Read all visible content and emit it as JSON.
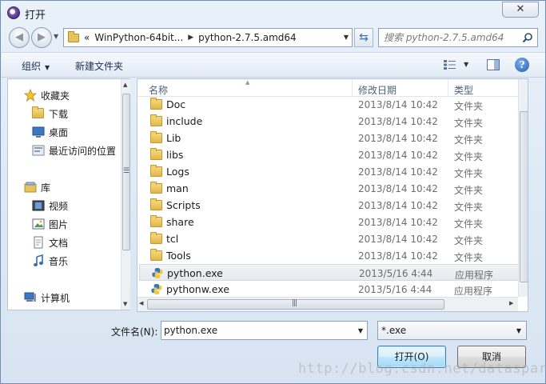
{
  "window": {
    "title": "打开",
    "close_glyph": "✕"
  },
  "nav": {
    "address": [
      "WinPython-64bit...",
      "python-2.7.5.amd64"
    ],
    "address_prefix": "«",
    "search_placeholder": "搜索 python-2.7.5.amd64"
  },
  "toolbar": {
    "organize": "组织",
    "new_folder": "新建文件夹"
  },
  "sidebar": {
    "favorites": {
      "label": "收藏夹",
      "items": [
        "下载",
        "桌面",
        "最近访问的位置"
      ]
    },
    "libraries": {
      "label": "库",
      "items": [
        "视频",
        "图片",
        "文档",
        "音乐"
      ]
    },
    "computer": "计算机"
  },
  "columns": {
    "name": "名称",
    "date": "修改日期",
    "type": "类型"
  },
  "files": [
    {
      "name": "Doc",
      "date": "2013/8/14 10:42",
      "type": "文件夹",
      "kind": "folder"
    },
    {
      "name": "include",
      "date": "2013/8/14 10:42",
      "type": "文件夹",
      "kind": "folder"
    },
    {
      "name": "Lib",
      "date": "2013/8/14 10:42",
      "type": "文件夹",
      "kind": "folder"
    },
    {
      "name": "libs",
      "date": "2013/8/14 10:42",
      "type": "文件夹",
      "kind": "folder"
    },
    {
      "name": "Logs",
      "date": "2013/8/14 10:42",
      "type": "文件夹",
      "kind": "folder"
    },
    {
      "name": "man",
      "date": "2013/8/14 10:42",
      "type": "文件夹",
      "kind": "folder"
    },
    {
      "name": "Scripts",
      "date": "2013/8/14 10:42",
      "type": "文件夹",
      "kind": "folder"
    },
    {
      "name": "share",
      "date": "2013/8/14 10:42",
      "type": "文件夹",
      "kind": "folder"
    },
    {
      "name": "tcl",
      "date": "2013/8/14 10:42",
      "type": "文件夹",
      "kind": "folder"
    },
    {
      "name": "Tools",
      "date": "2013/8/14 10:42",
      "type": "文件夹",
      "kind": "folder"
    },
    {
      "name": "python.exe",
      "date": "2013/5/16 4:44",
      "type": "应用程序",
      "kind": "exe",
      "selected": true
    },
    {
      "name": "pythonw.exe",
      "date": "2013/5/16 4:44",
      "type": "应用程序",
      "kind": "exe"
    }
  ],
  "bottom": {
    "filename_label": "文件名(N):",
    "filename_value": "python.exe",
    "filter_value": "*.exe",
    "open": "打开(O)",
    "cancel": "取消"
  },
  "watermark": "http://blog.csdn.net/dataspark"
}
